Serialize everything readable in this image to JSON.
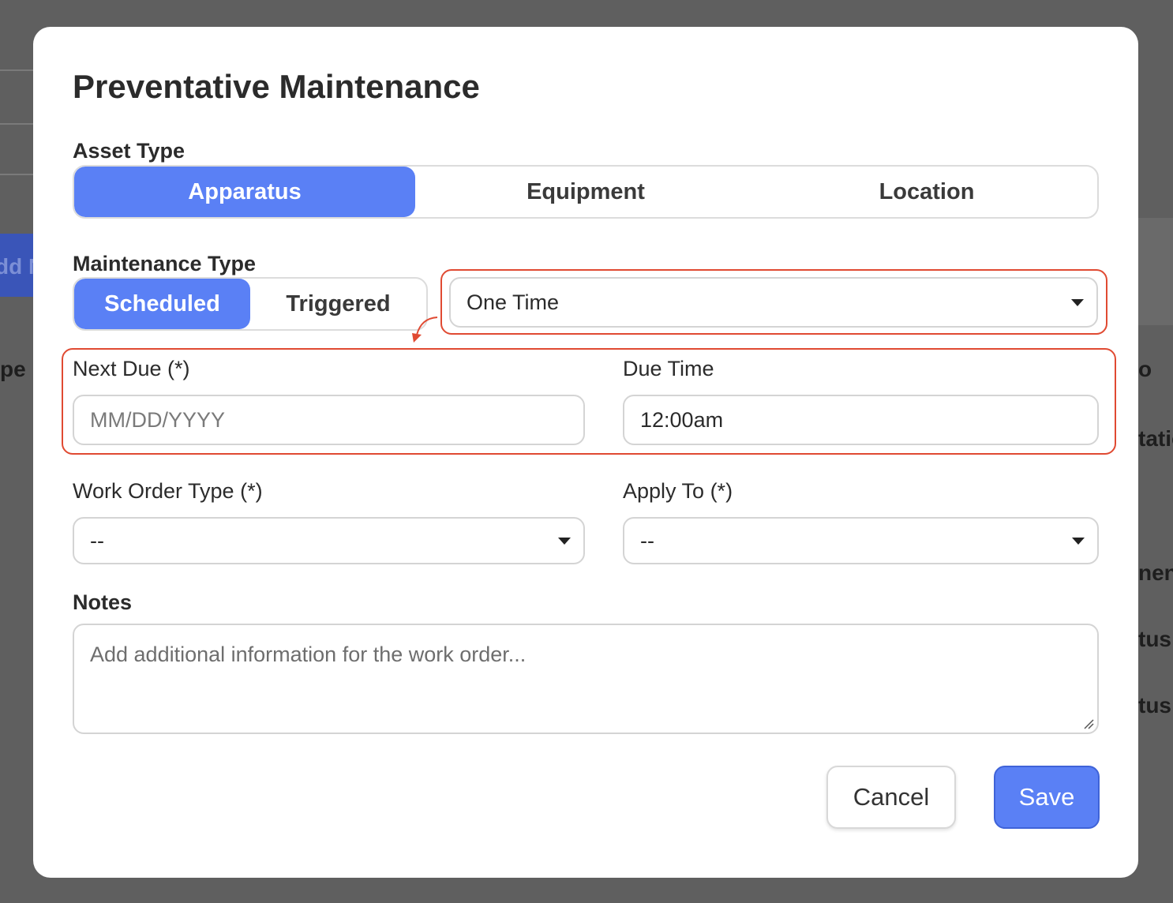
{
  "background": {
    "left_text": "dd N",
    "right_texts": [
      "pe",
      "o",
      "tatio",
      "nen",
      "tus",
      "tus"
    ]
  },
  "modal": {
    "title": "Preventative Maintenance",
    "asset_type": {
      "label": "Asset Type",
      "options": [
        "Apparatus",
        "Equipment",
        "Location"
      ],
      "selected": "Apparatus"
    },
    "maintenance_type": {
      "label": "Maintenance Type",
      "options": [
        "Scheduled",
        "Triggered"
      ],
      "selected": "Scheduled",
      "frequency_select": {
        "value": "One Time"
      }
    },
    "next_due": {
      "label": "Next Due (*)",
      "placeholder": "MM/DD/YYYY",
      "value": ""
    },
    "due_time": {
      "label": "Due Time",
      "value": "12:00am"
    },
    "work_order_type": {
      "label": "Work Order Type (*)",
      "value": "--"
    },
    "apply_to": {
      "label": "Apply To (*)",
      "value": "--"
    },
    "notes": {
      "label": "Notes",
      "placeholder": "Add additional information for the work order..."
    },
    "buttons": {
      "cancel": "Cancel",
      "save": "Save"
    }
  },
  "colors": {
    "accent": "#5a80f5",
    "annotation": "#e04a32",
    "overlay": "#5f5f5f"
  }
}
